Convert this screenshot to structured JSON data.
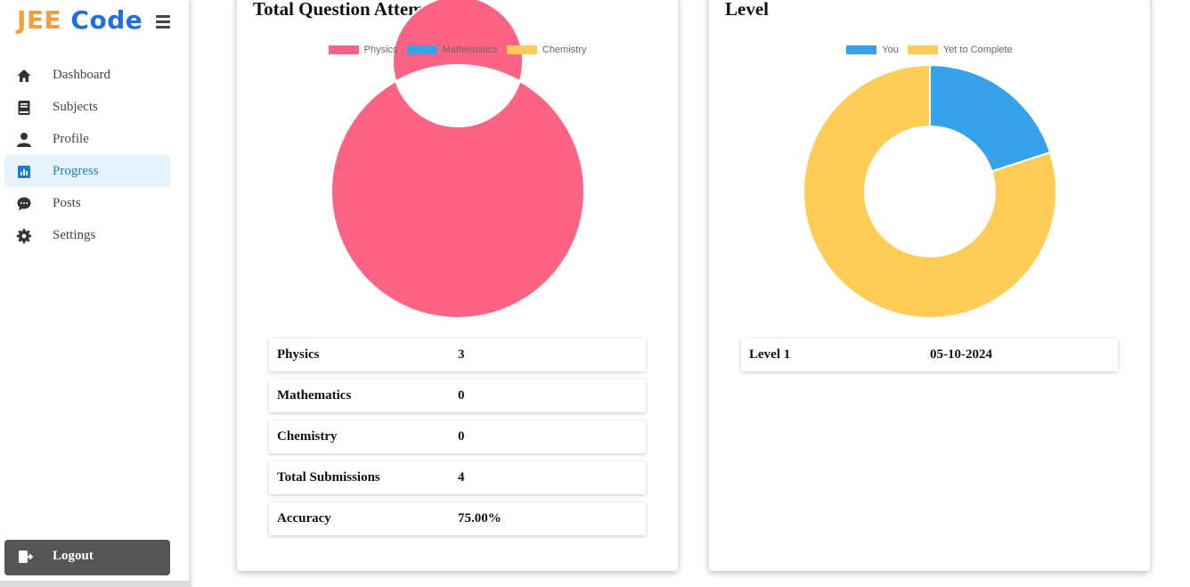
{
  "logo": {
    "part1": "JEE",
    "part2": "Code",
    "menu_icon": "hamburger-icon"
  },
  "sidebar": {
    "items": [
      {
        "label": "Dashboard",
        "icon": "home-icon",
        "active": false
      },
      {
        "label": "Subjects",
        "icon": "book-icon",
        "active": false
      },
      {
        "label": "Profile",
        "icon": "user-icon",
        "active": false
      },
      {
        "label": "Progress",
        "icon": "chart-icon",
        "active": true
      },
      {
        "label": "Posts",
        "icon": "chat-icon",
        "active": false
      },
      {
        "label": "Settings",
        "icon": "gear-icon",
        "active": false
      }
    ],
    "logout_label": "Logout"
  },
  "colors": {
    "physics": "#ff6384",
    "mathematics": "#36a2eb",
    "chemistry": "#ffcd56",
    "active_bg": "#e6f3fd",
    "active_text": "#1a7fc4"
  },
  "questions_card": {
    "title": "Total Question Attemped",
    "stats": [
      {
        "key": "Physics",
        "value": "3"
      },
      {
        "key": "Mathematics",
        "value": "0"
      },
      {
        "key": "Chemistry",
        "value": "0"
      },
      {
        "key": "Total Submissions",
        "value": "4"
      },
      {
        "key": "Accuracy",
        "value": "75.00%"
      }
    ]
  },
  "level_card": {
    "title": "Level",
    "stats": [
      {
        "key": "Level 1",
        "value": "05-10-2024"
      }
    ]
  },
  "chart_data": [
    {
      "type": "pie",
      "variant": "doughnut",
      "legend_position": "top",
      "categories": [
        "Physics",
        "Mathematics",
        "Chemistry"
      ],
      "values": [
        3,
        0,
        0
      ],
      "colors": [
        "#ff6384",
        "#36a2eb",
        "#ffcd56"
      ]
    },
    {
      "type": "pie",
      "variant": "doughnut",
      "legend_position": "top",
      "categories": [
        "You",
        "Yet to Complete"
      ],
      "values": [
        1,
        4
      ],
      "colors": [
        "#36a2eb",
        "#ffcd56"
      ]
    }
  ]
}
